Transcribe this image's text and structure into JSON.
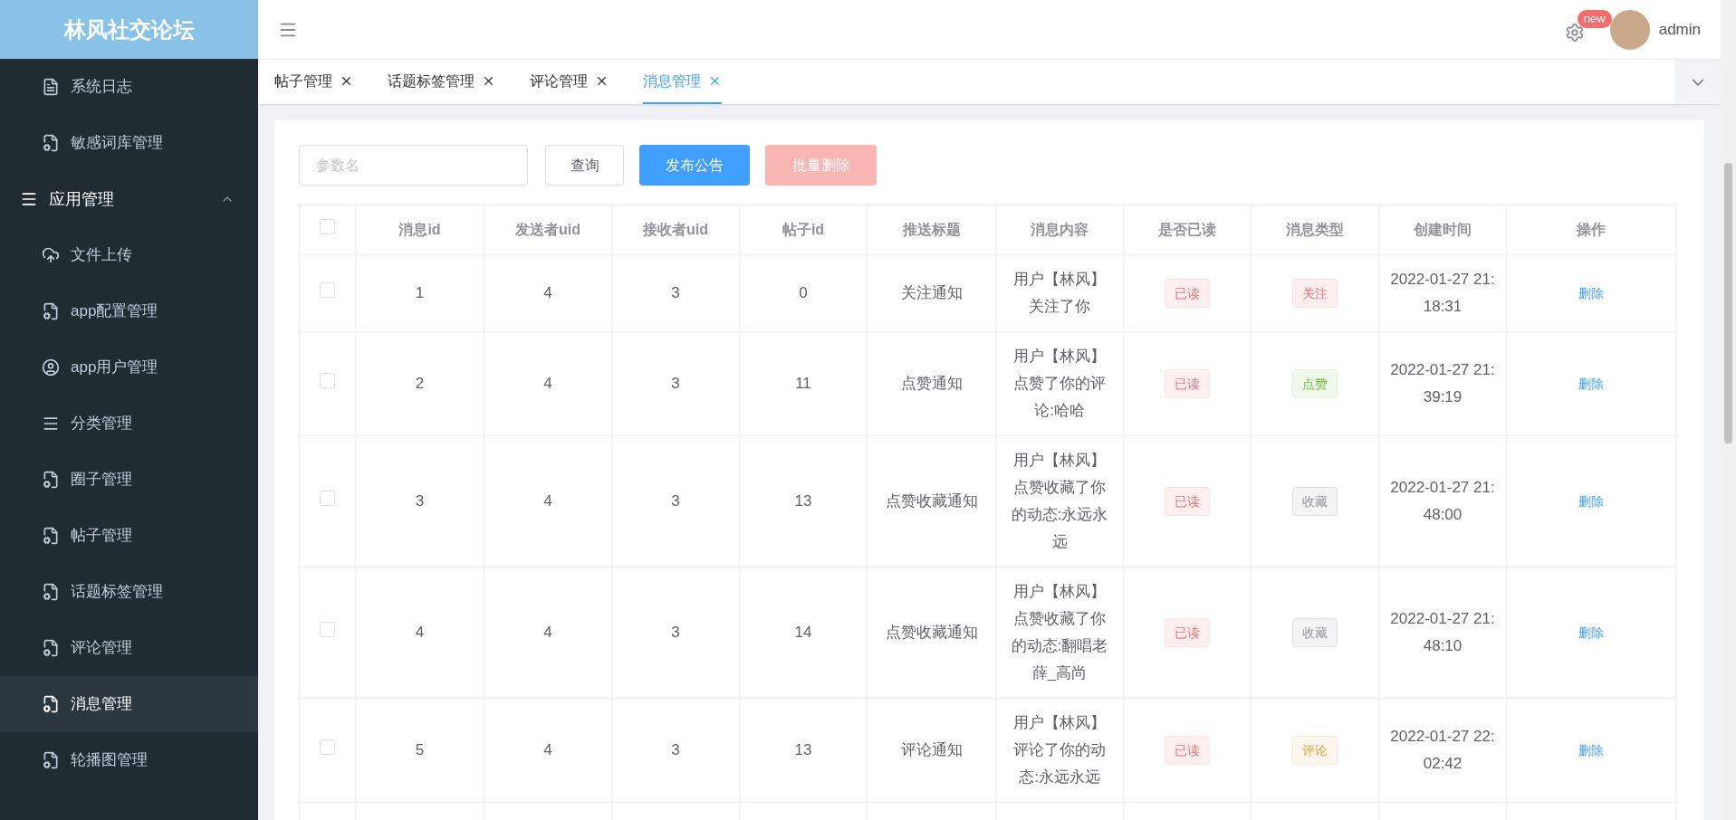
{
  "sidebar": {
    "logo": "林风社交论坛",
    "items": [
      {
        "kind": "doc",
        "label": "系统日志",
        "selected": false
      },
      {
        "kind": "doc-gear",
        "label": "敏感词库管理",
        "selected": false
      }
    ],
    "group": {
      "label": "应用管理",
      "expanded": true,
      "children": [
        {
          "kind": "cloud",
          "label": "文件上传",
          "selected": false
        },
        {
          "kind": "doc-gear",
          "label": "app配置管理",
          "selected": false
        },
        {
          "kind": "user",
          "label": "app用户管理",
          "selected": false
        },
        {
          "kind": "list",
          "label": "分类管理",
          "selected": false
        },
        {
          "kind": "doc-gear",
          "label": "圈子管理",
          "selected": false
        },
        {
          "kind": "doc-gear",
          "label": "帖子管理",
          "selected": false
        },
        {
          "kind": "doc-gear",
          "label": "话题标签管理",
          "selected": false
        },
        {
          "kind": "doc-gear",
          "label": "评论管理",
          "selected": false
        },
        {
          "kind": "doc-gear",
          "label": "消息管理",
          "selected": true
        },
        {
          "kind": "doc-gear",
          "label": "轮播图管理",
          "selected": false
        }
      ]
    }
  },
  "header": {
    "badge": "new",
    "user": "admin"
  },
  "tabs": [
    {
      "label": "帖子管理",
      "selected": false
    },
    {
      "label": "话题标签管理",
      "selected": false
    },
    {
      "label": "评论管理",
      "selected": false
    },
    {
      "label": "消息管理",
      "selected": true
    }
  ],
  "toolbar": {
    "search": {
      "placeholder": "参数名"
    },
    "buttons": [
      {
        "kind": "default",
        "label": "查询",
        "disabled": false
      },
      {
        "kind": "primary",
        "label": "发布公告",
        "disabled": false
      },
      {
        "kind": "danger",
        "label": "批量删除",
        "disabled": true
      }
    ]
  },
  "table": {
    "columns": [
      "消息id",
      "发送者uid",
      "接收者uid",
      "帖子id",
      "推送标题",
      "消息内容",
      "是否已读",
      "消息类型",
      "创建时间",
      "操作"
    ],
    "header_checked": false,
    "rows": [
      {
        "checked": false,
        "id": "1",
        "sender": "4",
        "receiver": "3",
        "post": "0",
        "title": "关注通知",
        "content": "用户【林风】关注了你",
        "read": true,
        "read_label": "已读",
        "type": {
          "kind": "follow",
          "label": "关注"
        },
        "time": "2022-01-27 21:18:31",
        "action": "删除"
      },
      {
        "checked": false,
        "id": "2",
        "sender": "4",
        "receiver": "3",
        "post": "11",
        "title": "点赞通知",
        "content": "用户【林风】点赞了你的评论:哈哈",
        "read": true,
        "read_label": "已读",
        "type": {
          "kind": "like",
          "label": "点赞"
        },
        "time": "2022-01-27 21:39:19",
        "action": "删除"
      },
      {
        "checked": false,
        "id": "3",
        "sender": "4",
        "receiver": "3",
        "post": "13",
        "title": "点赞收藏通知",
        "content": "用户【林风】点赞收藏了你的动态:永远永远",
        "read": true,
        "read_label": "已读",
        "type": {
          "kind": "favorite",
          "label": "收藏"
        },
        "time": "2022-01-27 21:48:00",
        "action": "删除"
      },
      {
        "checked": false,
        "id": "4",
        "sender": "4",
        "receiver": "3",
        "post": "14",
        "title": "点赞收藏通知",
        "content": "用户【林风】点赞收藏了你的动态:翻唱老薛_高尚",
        "read": true,
        "read_label": "已读",
        "type": {
          "kind": "favorite",
          "label": "收藏"
        },
        "time": "2022-01-27 21:48:10",
        "action": "删除"
      },
      {
        "checked": false,
        "id": "5",
        "sender": "4",
        "receiver": "3",
        "post": "13",
        "title": "评论通知",
        "content": "用户【林风】评论了你的动态:永远永远",
        "read": true,
        "read_label": "已读",
        "type": {
          "kind": "comment",
          "label": "评论"
        },
        "time": "2022-01-27 22:02:42",
        "action": "删除"
      }
    ]
  }
}
